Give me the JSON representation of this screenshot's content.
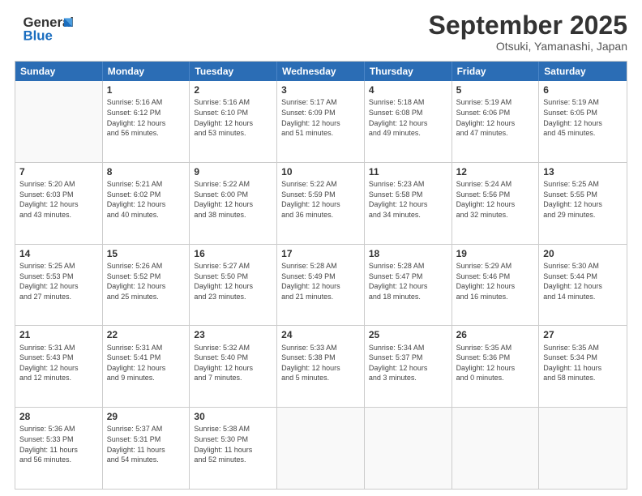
{
  "header": {
    "logo_line1": "General",
    "logo_line2": "Blue",
    "month": "September 2025",
    "location": "Otsuki, Yamanashi, Japan"
  },
  "weekdays": [
    "Sunday",
    "Monday",
    "Tuesday",
    "Wednesday",
    "Thursday",
    "Friday",
    "Saturday"
  ],
  "weeks": [
    [
      {
        "day": "",
        "text": ""
      },
      {
        "day": "1",
        "text": "Sunrise: 5:16 AM\nSunset: 6:12 PM\nDaylight: 12 hours\nand 56 minutes."
      },
      {
        "day": "2",
        "text": "Sunrise: 5:16 AM\nSunset: 6:10 PM\nDaylight: 12 hours\nand 53 minutes."
      },
      {
        "day": "3",
        "text": "Sunrise: 5:17 AM\nSunset: 6:09 PM\nDaylight: 12 hours\nand 51 minutes."
      },
      {
        "day": "4",
        "text": "Sunrise: 5:18 AM\nSunset: 6:08 PM\nDaylight: 12 hours\nand 49 minutes."
      },
      {
        "day": "5",
        "text": "Sunrise: 5:19 AM\nSunset: 6:06 PM\nDaylight: 12 hours\nand 47 minutes."
      },
      {
        "day": "6",
        "text": "Sunrise: 5:19 AM\nSunset: 6:05 PM\nDaylight: 12 hours\nand 45 minutes."
      }
    ],
    [
      {
        "day": "7",
        "text": "Sunrise: 5:20 AM\nSunset: 6:03 PM\nDaylight: 12 hours\nand 43 minutes."
      },
      {
        "day": "8",
        "text": "Sunrise: 5:21 AM\nSunset: 6:02 PM\nDaylight: 12 hours\nand 40 minutes."
      },
      {
        "day": "9",
        "text": "Sunrise: 5:22 AM\nSunset: 6:00 PM\nDaylight: 12 hours\nand 38 minutes."
      },
      {
        "day": "10",
        "text": "Sunrise: 5:22 AM\nSunset: 5:59 PM\nDaylight: 12 hours\nand 36 minutes."
      },
      {
        "day": "11",
        "text": "Sunrise: 5:23 AM\nSunset: 5:58 PM\nDaylight: 12 hours\nand 34 minutes."
      },
      {
        "day": "12",
        "text": "Sunrise: 5:24 AM\nSunset: 5:56 PM\nDaylight: 12 hours\nand 32 minutes."
      },
      {
        "day": "13",
        "text": "Sunrise: 5:25 AM\nSunset: 5:55 PM\nDaylight: 12 hours\nand 29 minutes."
      }
    ],
    [
      {
        "day": "14",
        "text": "Sunrise: 5:25 AM\nSunset: 5:53 PM\nDaylight: 12 hours\nand 27 minutes."
      },
      {
        "day": "15",
        "text": "Sunrise: 5:26 AM\nSunset: 5:52 PM\nDaylight: 12 hours\nand 25 minutes."
      },
      {
        "day": "16",
        "text": "Sunrise: 5:27 AM\nSunset: 5:50 PM\nDaylight: 12 hours\nand 23 minutes."
      },
      {
        "day": "17",
        "text": "Sunrise: 5:28 AM\nSunset: 5:49 PM\nDaylight: 12 hours\nand 21 minutes."
      },
      {
        "day": "18",
        "text": "Sunrise: 5:28 AM\nSunset: 5:47 PM\nDaylight: 12 hours\nand 18 minutes."
      },
      {
        "day": "19",
        "text": "Sunrise: 5:29 AM\nSunset: 5:46 PM\nDaylight: 12 hours\nand 16 minutes."
      },
      {
        "day": "20",
        "text": "Sunrise: 5:30 AM\nSunset: 5:44 PM\nDaylight: 12 hours\nand 14 minutes."
      }
    ],
    [
      {
        "day": "21",
        "text": "Sunrise: 5:31 AM\nSunset: 5:43 PM\nDaylight: 12 hours\nand 12 minutes."
      },
      {
        "day": "22",
        "text": "Sunrise: 5:31 AM\nSunset: 5:41 PM\nDaylight: 12 hours\nand 9 minutes."
      },
      {
        "day": "23",
        "text": "Sunrise: 5:32 AM\nSunset: 5:40 PM\nDaylight: 12 hours\nand 7 minutes."
      },
      {
        "day": "24",
        "text": "Sunrise: 5:33 AM\nSunset: 5:38 PM\nDaylight: 12 hours\nand 5 minutes."
      },
      {
        "day": "25",
        "text": "Sunrise: 5:34 AM\nSunset: 5:37 PM\nDaylight: 12 hours\nand 3 minutes."
      },
      {
        "day": "26",
        "text": "Sunrise: 5:35 AM\nSunset: 5:36 PM\nDaylight: 12 hours\nand 0 minutes."
      },
      {
        "day": "27",
        "text": "Sunrise: 5:35 AM\nSunset: 5:34 PM\nDaylight: 11 hours\nand 58 minutes."
      }
    ],
    [
      {
        "day": "28",
        "text": "Sunrise: 5:36 AM\nSunset: 5:33 PM\nDaylight: 11 hours\nand 56 minutes."
      },
      {
        "day": "29",
        "text": "Sunrise: 5:37 AM\nSunset: 5:31 PM\nDaylight: 11 hours\nand 54 minutes."
      },
      {
        "day": "30",
        "text": "Sunrise: 5:38 AM\nSunset: 5:30 PM\nDaylight: 11 hours\nand 52 minutes."
      },
      {
        "day": "",
        "text": ""
      },
      {
        "day": "",
        "text": ""
      },
      {
        "day": "",
        "text": ""
      },
      {
        "day": "",
        "text": ""
      }
    ]
  ]
}
